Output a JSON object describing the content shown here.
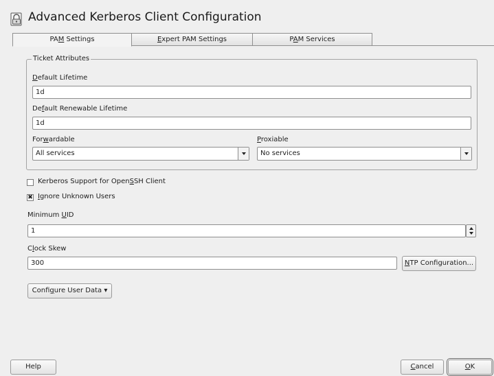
{
  "window": {
    "title": "Advanced Kerberos Client Configuration"
  },
  "tabs": [
    {
      "label": "PAM Settings",
      "mnemonic_before": "PA",
      "mnemonic": "M",
      "mnemonic_after": " Settings",
      "active": true
    },
    {
      "label": "Expert PAM Settings",
      "mnemonic_before": "",
      "mnemonic": "E",
      "mnemonic_after": "xpert PAM Settings",
      "active": false
    },
    {
      "label": "PAM Services",
      "mnemonic_before": "P",
      "mnemonic": "A",
      "mnemonic_after": "M Services",
      "active": false
    }
  ],
  "ticket_attributes": {
    "legend": "Ticket Attributes",
    "default_lifetime": {
      "label_before": "",
      "label_mnemonic": "D",
      "label_after": "efault Lifetime",
      "value": "1d"
    },
    "default_renewable_lifetime": {
      "label_before": "De",
      "label_mnemonic": "f",
      "label_after": "ault Renewable Lifetime",
      "value": "1d"
    },
    "forwardable": {
      "label_before": "For",
      "label_mnemonic": "w",
      "label_after": "ardable",
      "value": "All services"
    },
    "proxiable": {
      "label_before": "",
      "label_mnemonic": "P",
      "label_after": "roxiable",
      "value": "No services"
    }
  },
  "options": {
    "openssh_support": {
      "label_before": "Kerberos Support for Open",
      "label_mnemonic": "S",
      "label_after": "SH Client",
      "checked": false
    },
    "ignore_unknown_users": {
      "label_before": "",
      "label_mnemonic": "I",
      "label_after": "gnore Unknown Users",
      "checked": true,
      "check_mark": "✖"
    }
  },
  "minimum_uid": {
    "label_before": "Minimum ",
    "label_mnemonic": "U",
    "label_after": "ID",
    "value": "1"
  },
  "clock_skew": {
    "label_before": "C",
    "label_mnemonic": "l",
    "label_after": "ock Skew",
    "value": "300"
  },
  "ntp_button": {
    "label_before": "",
    "label_mnemonic": "N",
    "label_after": "TP Configuration..."
  },
  "configure_user_data": {
    "label_before": "Confi",
    "label_mnemonic": "g",
    "label_after": "ure User Data",
    "dropdown_glyph": "▾"
  },
  "footer": {
    "help": "Help",
    "cancel": {
      "label_before": "",
      "label_mnemonic": "C",
      "label_after": "ancel"
    },
    "ok": {
      "label_before": "",
      "label_mnemonic": "O",
      "label_after": "K"
    }
  }
}
